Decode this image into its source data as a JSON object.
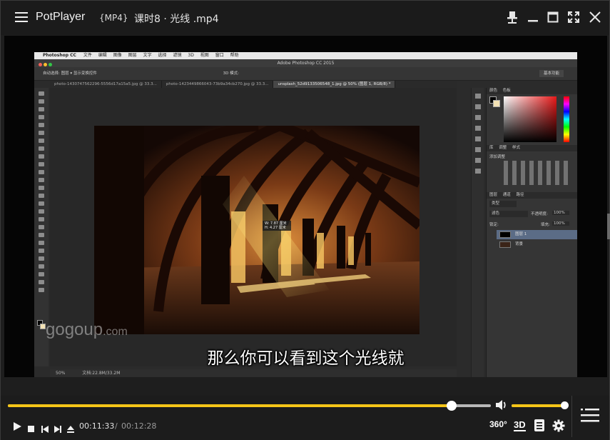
{
  "titlebar": {
    "app_name": "PotPlayer",
    "format_tag": "{MP4}",
    "file_name": "课时8 · 光线   .mp4"
  },
  "video": {
    "subtitle": "那么你可以看到这个光线就",
    "watermark_main": "gogoup",
    "watermark_suffix": ".com",
    "photoshop": {
      "app_menu": "Photoshop CC",
      "menu_items": [
        "文件",
        "编辑",
        "图像",
        "图层",
        "文字",
        "选择",
        "滤镜",
        "3D",
        "视图",
        "窗口",
        "帮助"
      ],
      "window_title": "Adobe Photoshop CC 2015",
      "options_bar": "自动选择:  图层  ▾    显示变换控件",
      "options_mode": "3D 模式:",
      "workspace": "基本功能",
      "doc_tabs": [
        "photo-1430747562296-5556d17a15a5.jpg @ 33.3...",
        "photo-1423449866043-73b9a34cb270.jpg @ 33.3...",
        "unsplash_52d9133506548_1.jpg @ 50% (图层 1, RGB/8) *"
      ],
      "measure_w": "W: 7.87 厘米",
      "measure_h": "H: 4.27 厘米",
      "status_zoom": "50%",
      "status_doc": "文档:22.8M/33.2M",
      "panel_color_tabs": [
        "颜色",
        "色板"
      ],
      "panel_adjust_tabs": [
        "库",
        "调整",
        "样式"
      ],
      "panel_adjust_title": "添加调整",
      "panel_layers_tabs": [
        "图层",
        "通道",
        "路径"
      ],
      "layers_kind": "类型",
      "blend_mode": "滤色",
      "opacity_label": "不透明度:",
      "opacity_value": "100%",
      "lock_label": "锁定:",
      "fill_label": "填充:",
      "fill_value": "100%",
      "layers": [
        "图层 1",
        "背景"
      ]
    }
  },
  "controls": {
    "progress": 0.9193,
    "volume": 1.0,
    "current_time": "00:11:33",
    "separator": "/",
    "total_time": "00:12:28",
    "btn_360": "360°",
    "btn_3d": "3D",
    "accent": "#f5c518"
  }
}
